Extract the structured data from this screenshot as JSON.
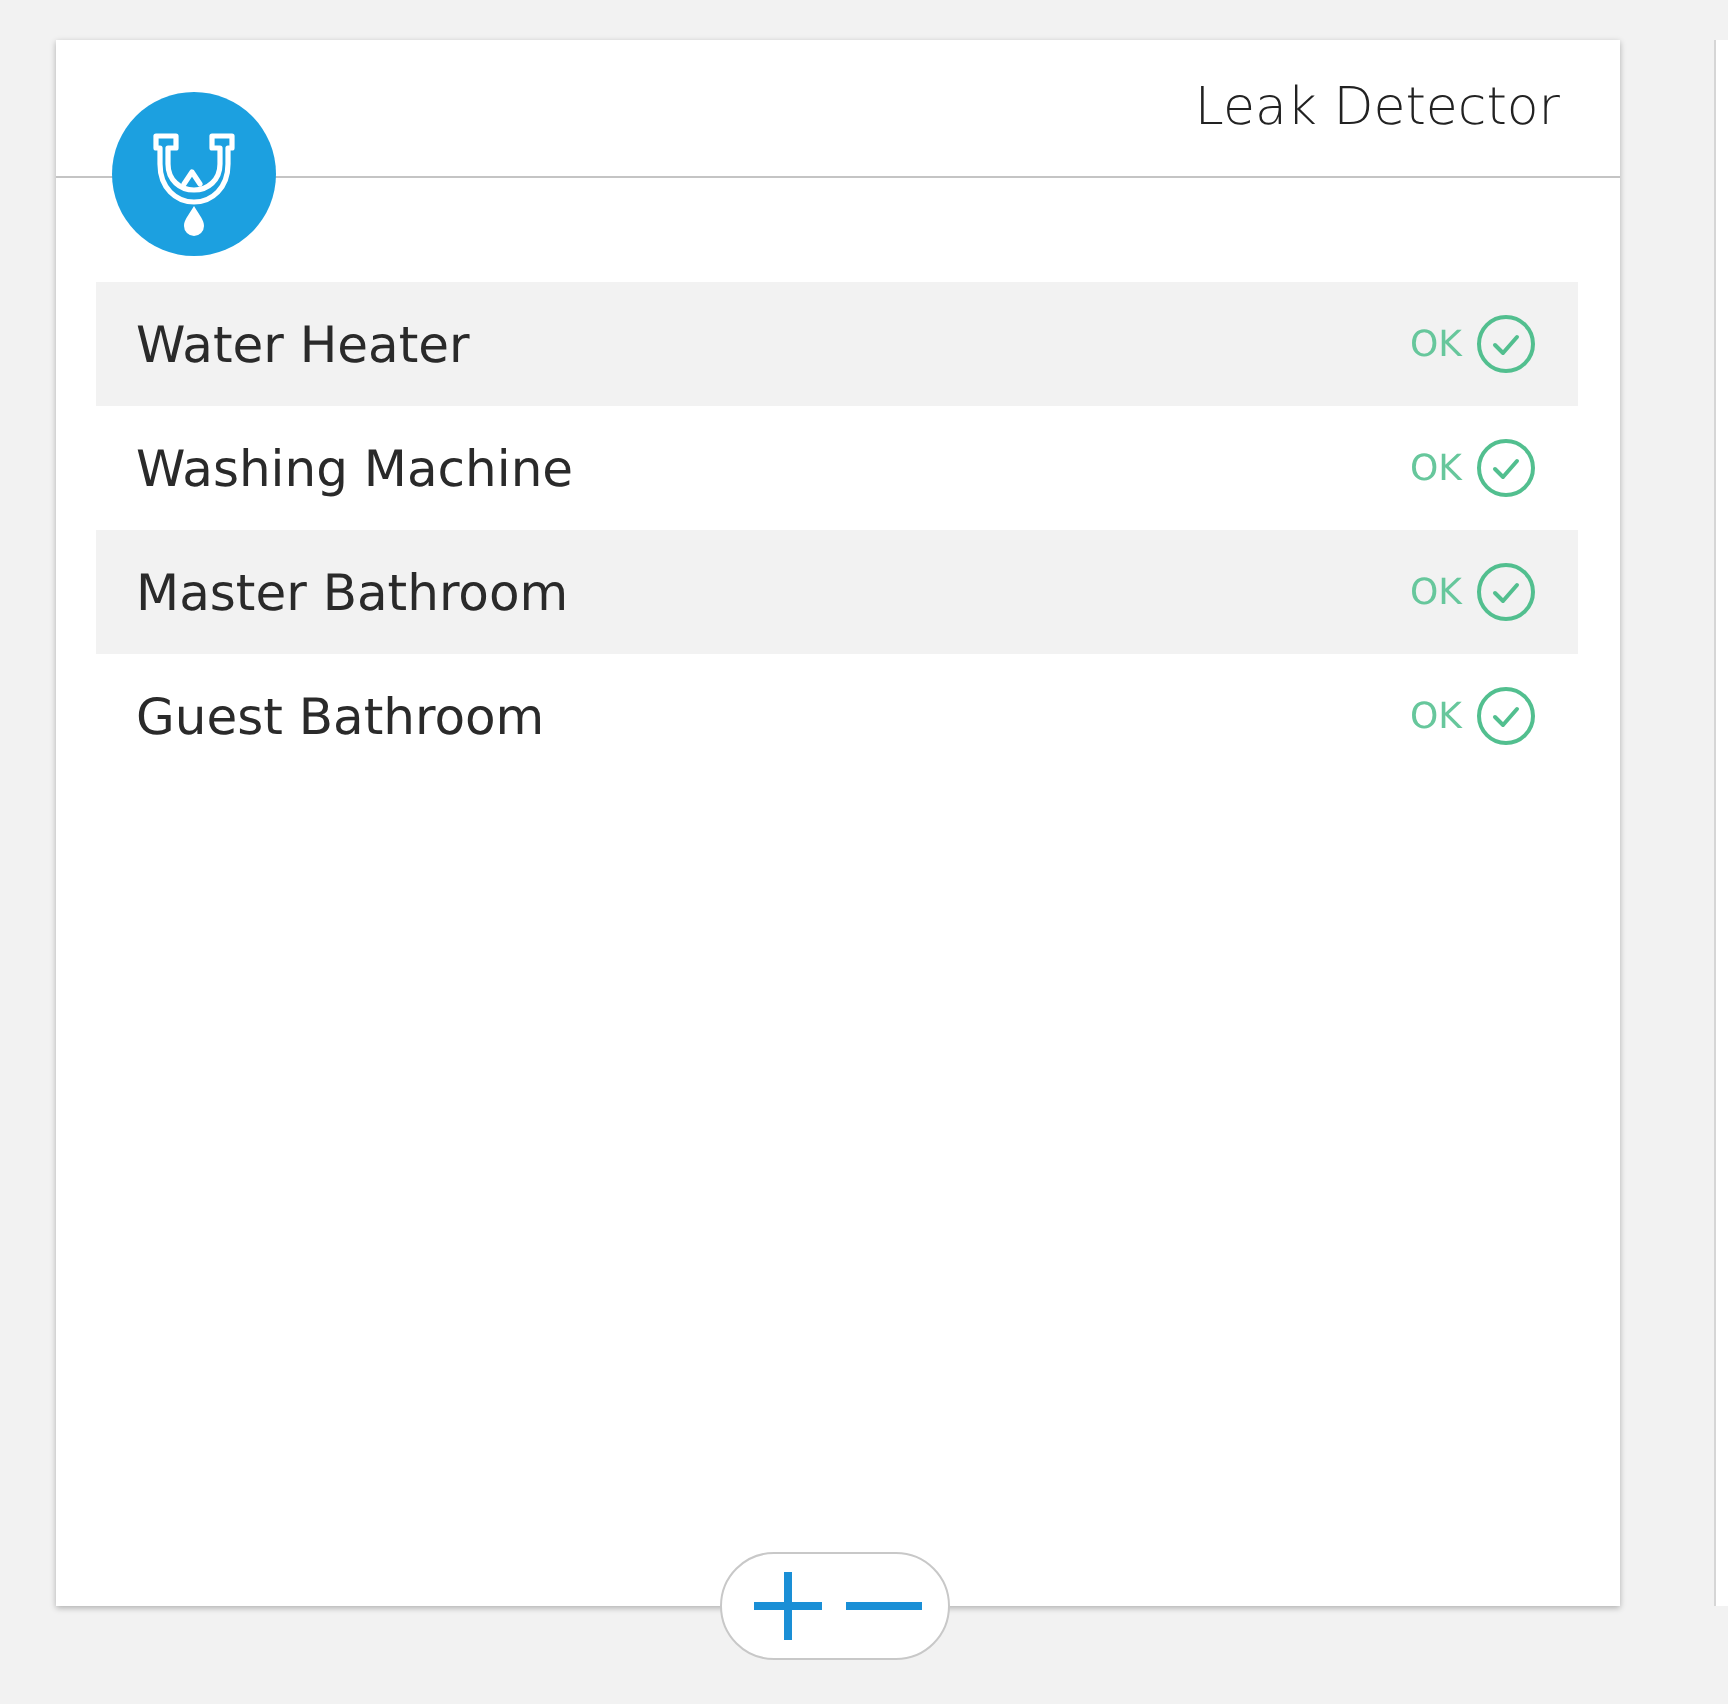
{
  "header": {
    "title": "Leak Detector"
  },
  "sensors": [
    {
      "name": "Water Heater",
      "status": "OK",
      "ok": true
    },
    {
      "name": "Washing Machine",
      "status": "OK",
      "ok": true
    },
    {
      "name": "Master Bathroom",
      "status": "OK",
      "ok": true
    },
    {
      "name": "Guest Bathroom",
      "status": "OK",
      "ok": true
    }
  ]
}
